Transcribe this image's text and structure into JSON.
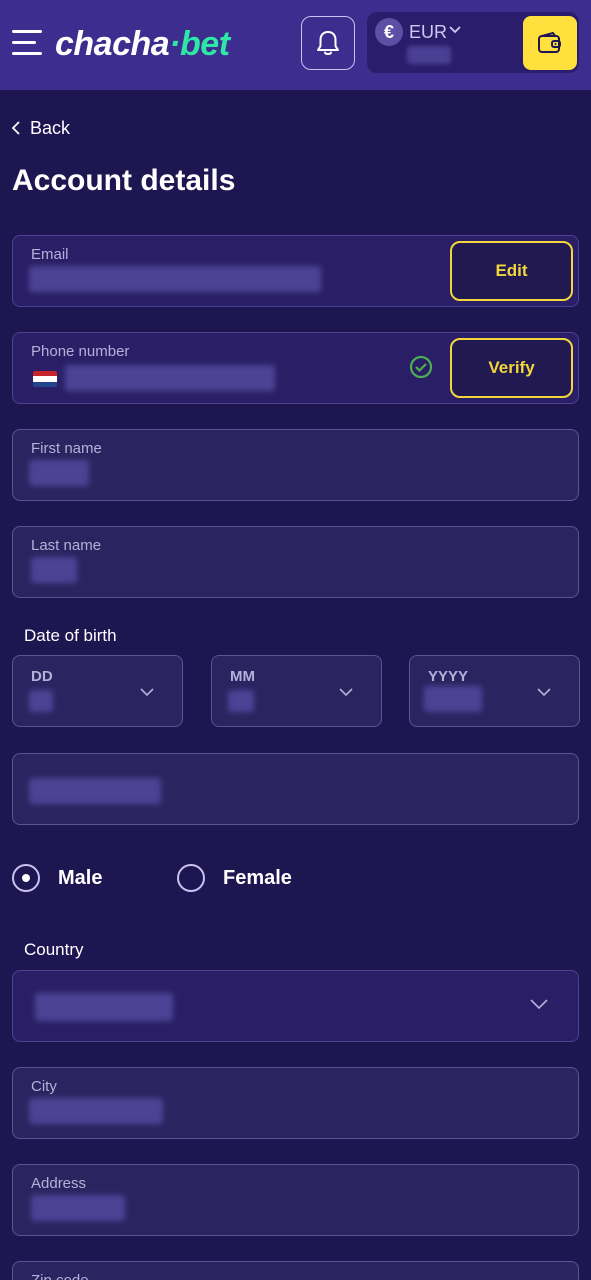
{
  "header": {
    "logo_part1": "chacha",
    "logo_part2": "·bet",
    "currency": "EUR",
    "currency_symbol": "€",
    "icons": {
      "menu": "hamburger-menu-icon",
      "notifications": "bell-icon",
      "wallet": "wallet-icon"
    },
    "colors": {
      "bar": "#3d2d8e",
      "accent": "#ffe03d",
      "logo_accent": "#2ee6a6"
    }
  },
  "nav": {
    "back_label": "Back"
  },
  "page": {
    "title": "Account details"
  },
  "form": {
    "email": {
      "label": "Email",
      "button": "Edit"
    },
    "phone": {
      "label": "Phone number",
      "button": "Verify",
      "verified": true
    },
    "first_name": {
      "label": "First name"
    },
    "last_name": {
      "label": "Last name"
    },
    "dob": {
      "label": "Date of birth",
      "day_placeholder": "DD",
      "month_placeholder": "MM",
      "year_placeholder": "YYYY"
    },
    "gender": {
      "options": [
        "Male",
        "Female"
      ],
      "selected": "Male"
    },
    "country": {
      "label": "Country"
    },
    "city": {
      "label": "City"
    },
    "address": {
      "label": "Address"
    },
    "zip": {
      "label": "Zip code"
    }
  },
  "colors": {
    "background": "#1e1650",
    "button_border": "#f2d63d",
    "verified": "#4caf50"
  }
}
